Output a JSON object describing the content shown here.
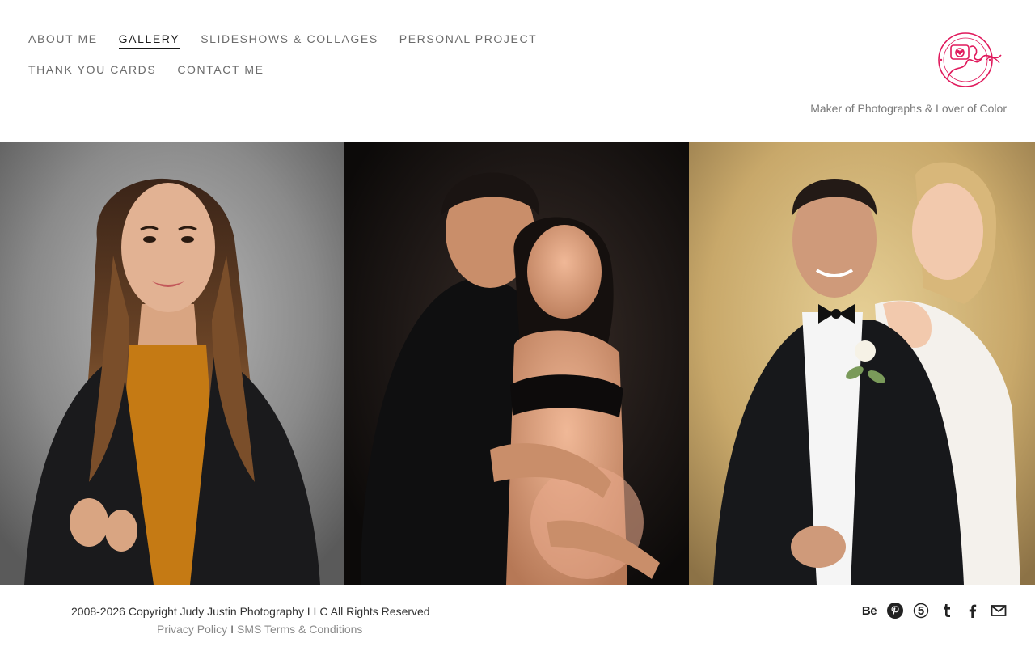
{
  "nav": {
    "row1": [
      {
        "label": "ABOUT ME",
        "active": false
      },
      {
        "label": "GALLERY",
        "active": true
      },
      {
        "label": "SLIDESHOWS & COLLAGES",
        "active": false
      },
      {
        "label": "PERSONAL PROJECT",
        "active": false
      }
    ],
    "row2": [
      {
        "label": "THANK YOU CARDS",
        "active": false
      },
      {
        "label": "CONTACT ME",
        "active": false
      }
    ]
  },
  "brand": {
    "tagline": "Maker of Photographs & Lover of Color",
    "logo_color": "#e0195c"
  },
  "gallery": {
    "photos": [
      {
        "subject": "portrait of woman in black blazer and mustard top"
      },
      {
        "subject": "maternity couple portrait on dark background"
      },
      {
        "subject": "wedding couple portrait on golden background"
      }
    ]
  },
  "footer": {
    "copyright": "2008-2026 Copyright Judy Justin Photography LLC All Rights Reserved",
    "privacy": "Privacy Policy",
    "separator": "I",
    "sms_terms": "SMS Terms & Conditions",
    "social": [
      {
        "icon": "behance-icon",
        "glyph": "Bē"
      },
      {
        "icon": "pinterest-icon"
      },
      {
        "icon": "500px-icon"
      },
      {
        "icon": "tumblr-icon"
      },
      {
        "icon": "facebook-icon"
      },
      {
        "icon": "email-icon"
      }
    ]
  }
}
